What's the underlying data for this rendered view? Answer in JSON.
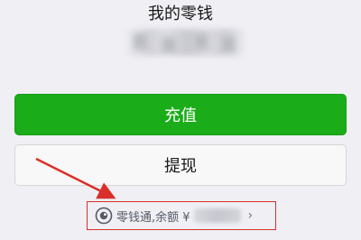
{
  "header": {
    "title": "我的零钱"
  },
  "actions": {
    "recharge_label": "充值",
    "withdraw_label": "提现"
  },
  "lingqiantong": {
    "label": "零钱通,余额 ¥",
    "chevron": "›",
    "icon": "lingqiantong-icon"
  },
  "colors": {
    "primary_green": "#1aad19",
    "annotation_red": "#d9302a",
    "background": "#efeff4"
  }
}
